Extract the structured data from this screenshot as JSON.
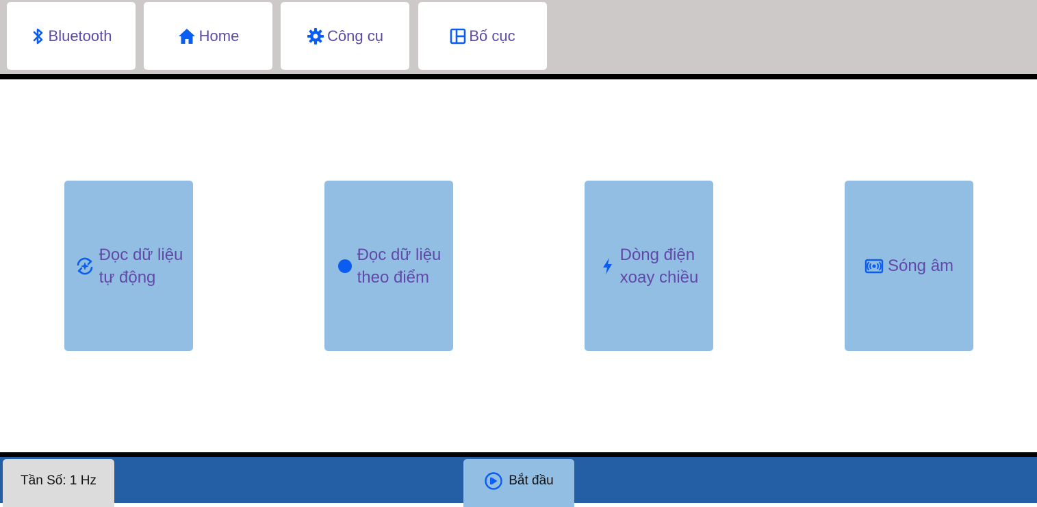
{
  "colors": {
    "topbar_bg": "#ccc9c8",
    "nav_text": "#5b4aa8",
    "icon_blue": "#0b5cf0",
    "card_bg": "#92bee3",
    "card_text": "#6149a8",
    "bottombar_bg": "#245fa6",
    "freq_bg": "#dcdcdc",
    "divider": "#000000"
  },
  "nav": {
    "items": [
      {
        "label": "Bluetooth",
        "icon": "bluetooth-icon"
      },
      {
        "label": "Home",
        "icon": "home-icon"
      },
      {
        "label": "Công cụ",
        "icon": "gear-icon"
      },
      {
        "label": "Bố cục",
        "icon": "layout-icon"
      }
    ]
  },
  "modes": {
    "items": [
      {
        "label": "Đọc dữ liệu\ntự động",
        "icon": "auto-refresh-icon"
      },
      {
        "label": "Đọc dữ liệu\ntheo điểm",
        "icon": "dot-icon"
      },
      {
        "label": "Dòng điện\nxoay chiều",
        "icon": "lightning-icon"
      },
      {
        "label": "Sóng âm",
        "icon": "sound-wave-icon"
      }
    ]
  },
  "footer": {
    "frequency_label": "Tần Số: 1 Hz",
    "start_label": "Bắt đầu",
    "start_icon": "play-circle-icon"
  }
}
